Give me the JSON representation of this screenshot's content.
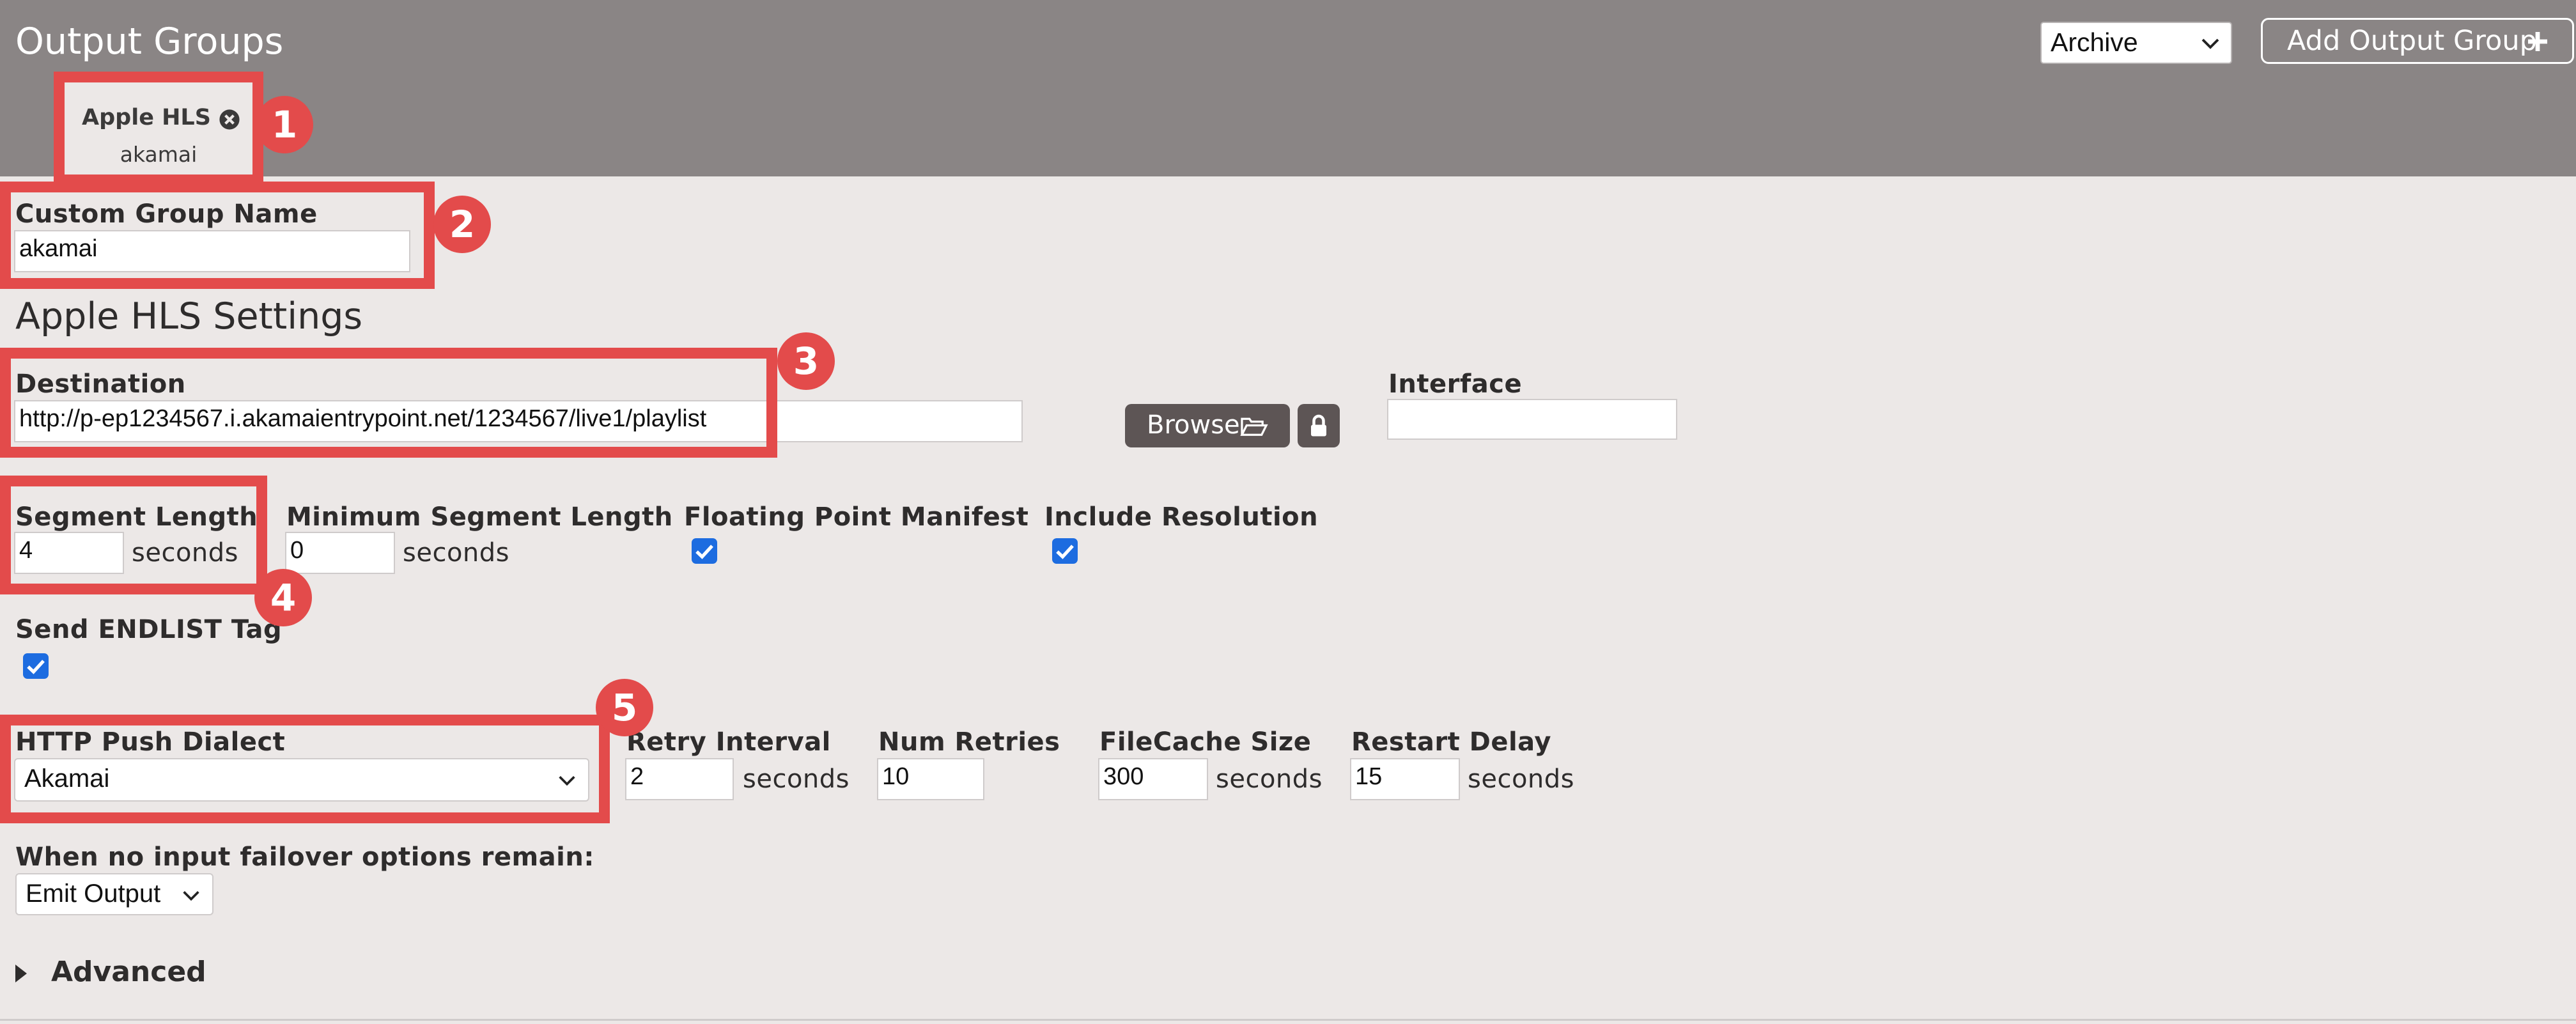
{
  "header": {
    "title": "Output Groups",
    "archive_select_value": "Archive",
    "add_button_label": "Add Output Group"
  },
  "tab": {
    "name": "Apple HLS",
    "subtitle": "akamai"
  },
  "custom_group_name": {
    "label": "Custom Group Name",
    "value": "akamai"
  },
  "section_title": "Apple HLS Settings",
  "destination": {
    "label": "Destination",
    "value": "http://p-ep1234567.i.akamaientrypoint.net/1234567/live1/playlist",
    "browse_label": "Browse"
  },
  "interface": {
    "label": "Interface",
    "value": ""
  },
  "segment_length": {
    "label": "Segment Length",
    "value": "4",
    "unit": "seconds"
  },
  "min_segment_length": {
    "label": "Minimum Segment Length",
    "value": "0",
    "unit": "seconds"
  },
  "floating_point_manifest": {
    "label": "Floating Point Manifest",
    "checked": true
  },
  "include_resolution": {
    "label": "Include Resolution",
    "checked": true
  },
  "send_endlist_tag": {
    "label": "Send ENDLIST Tag",
    "checked": true
  },
  "http_push_dialect": {
    "label": "HTTP Push Dialect",
    "value": "Akamai"
  },
  "retry_interval": {
    "label": "Retry Interval",
    "value": "2",
    "unit": "seconds"
  },
  "num_retries": {
    "label": "Num Retries",
    "value": "10"
  },
  "filecache_size": {
    "label": "FileCache Size",
    "value": "300",
    "unit": "seconds"
  },
  "restart_delay": {
    "label": "Restart Delay",
    "value": "15",
    "unit": "seconds"
  },
  "failover": {
    "label": "When no input failover options remain:",
    "value": "Emit Output"
  },
  "advanced_label": "Advanced",
  "callouts": [
    "1",
    "2",
    "3",
    "4",
    "5"
  ],
  "colors": {
    "header_bg": "#8a8585",
    "page_bg": "#ece8e7",
    "callout_red": "#e34b4b",
    "checkbox_blue": "#1d6ce0",
    "button_dark": "#5d5555"
  }
}
